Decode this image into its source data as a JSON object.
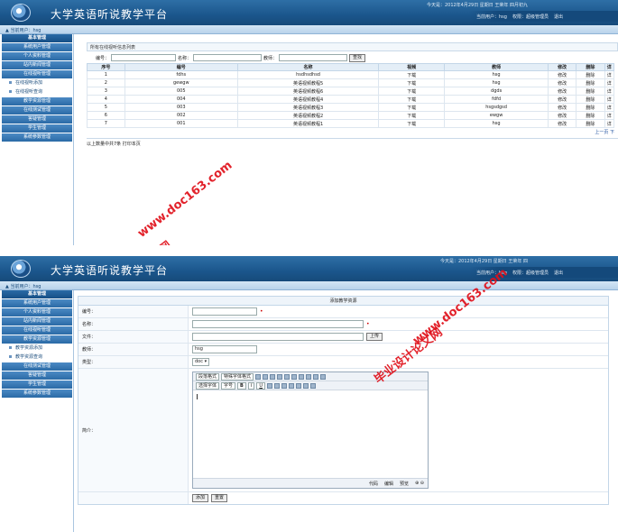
{
  "app": {
    "title": "大学英语听说教学平台",
    "date_text": "今天是：2012年4月29日 星期日 王荣年 四月初九",
    "date_text_2": "今天是：2012年4月29日 星期日 王荣年 四",
    "current_user": "当前用户：hsg",
    "permission": "权限：超级管理员",
    "logout": "退出"
  },
  "sidebar1": {
    "head": "基本管理",
    "items": [
      "系统用户管理",
      "个人资料管理",
      "站内新闻管理",
      "在线视听管理"
    ],
    "sub_items": [
      "在线视听添加",
      "在线视听查询"
    ],
    "items2": [
      "教学资源管理",
      "在线测试管理",
      "答疑管理",
      "学生管理",
      "系统参数管理"
    ]
  },
  "sidebar2": {
    "head": "基本管理",
    "items": [
      "系统用户管理",
      "个人资料管理",
      "站内新闻管理",
      "在线视听管理",
      "教学资源管理"
    ],
    "sub_items": [
      "教学资源添加",
      "教学资源查询"
    ],
    "items2": [
      "在线测试管理",
      "答疑管理",
      "学生管理",
      "系统参数管理"
    ]
  },
  "list_page": {
    "title": "所有在线视听信息列表",
    "search": {
      "code_label": "编号：",
      "name_label": "名称：",
      "teacher_label": "教师：",
      "button": "查找"
    },
    "columns": [
      "序号",
      "编号",
      "名称",
      "视频",
      "教师",
      "修改",
      "删除",
      "详"
    ],
    "rows": [
      [
        "1",
        "fdhs",
        "hsdhsdhsd",
        "下载",
        "hsg",
        "修改",
        "删除",
        "详"
      ],
      [
        "2",
        "gewgw",
        "英语视频教程5",
        "下载",
        "hsg",
        "修改",
        "删除",
        "详"
      ],
      [
        "3",
        "005",
        "英语视频教程6",
        "下载",
        "dgds",
        "修改",
        "删除",
        "详"
      ],
      [
        "4",
        "004",
        "英语视频教程4",
        "下载",
        "fdfd",
        "修改",
        "删除",
        "详"
      ],
      [
        "5",
        "003",
        "英语视频教程3",
        "下载",
        "hsgsdgsd",
        "修改",
        "删除",
        "详"
      ],
      [
        "6",
        "002",
        "英语视频教程2",
        "下载",
        "ewgw",
        "修改",
        "删除",
        "详"
      ],
      [
        "7",
        "001",
        "英语视频教程1",
        "下载",
        "hsg",
        "修改",
        "删除",
        "详"
      ]
    ],
    "pager": "上一页  下",
    "footer": "以上数量中共7条  打印本页"
  },
  "form_page": {
    "title": "添加教学资源",
    "labels": {
      "code": "编号：",
      "name": "名称：",
      "file": "文件：",
      "teacher": "教师：",
      "type": "类型：",
      "intro": "简介："
    },
    "file_button": "上传",
    "teacher_value": "hsg",
    "type_value": "doc",
    "editor": {
      "para_format": "段落格式",
      "special_format": "特殊字体格式",
      "font": "选择字体",
      "size": "字号",
      "bold": "B",
      "italic": "I",
      "underline": "U",
      "tabs": [
        "代码",
        "编辑",
        "预览"
      ]
    },
    "buttons": {
      "add": "添加",
      "reset": "重置"
    }
  },
  "watermark": {
    "a": "毕业设计论文网",
    "b": "www.doc163.com"
  }
}
